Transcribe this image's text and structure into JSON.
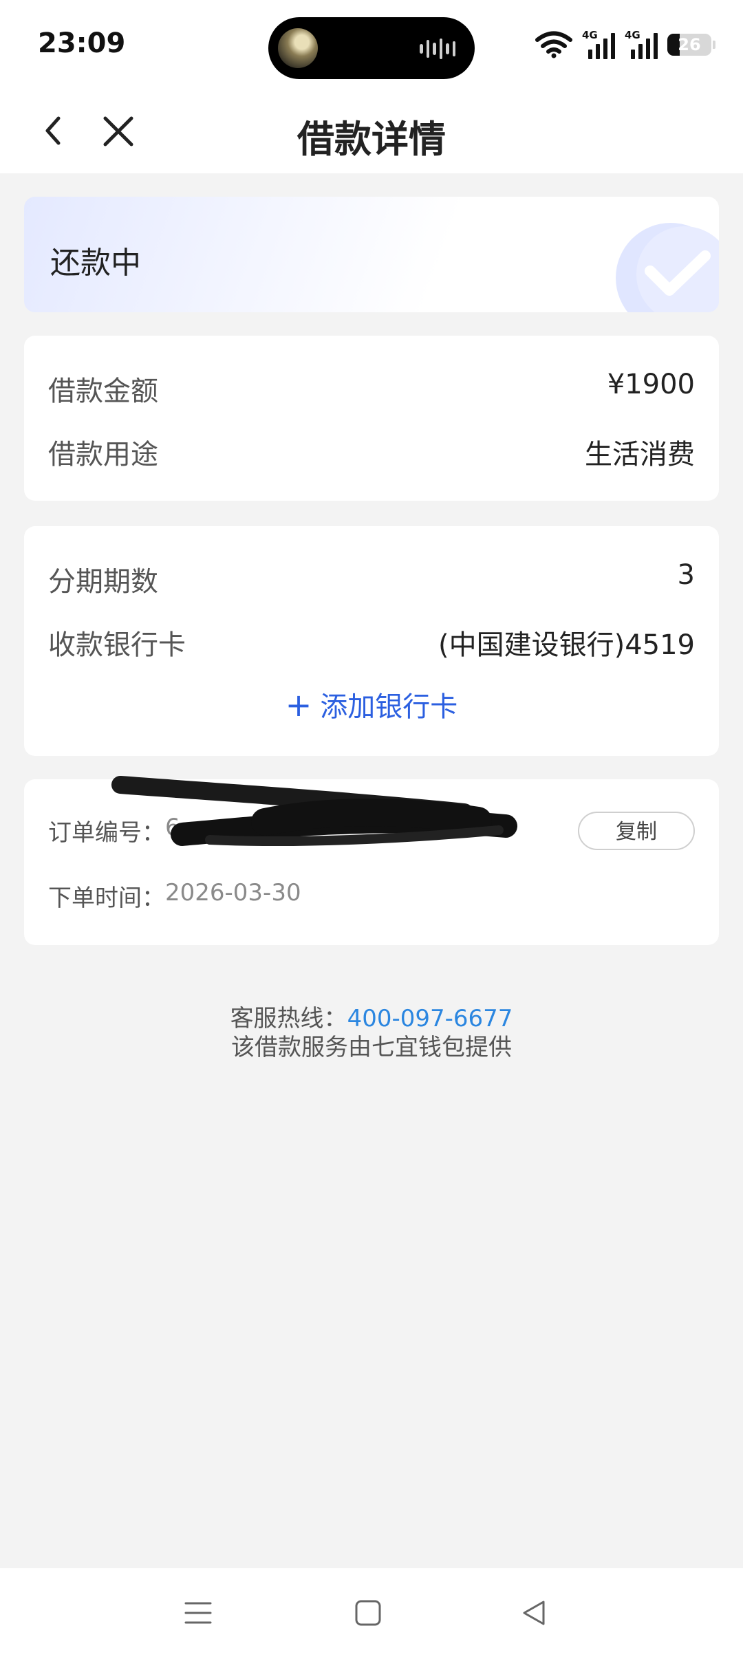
{
  "status_bar": {
    "time": "23:09",
    "network_1": "4G",
    "network_2": "4G",
    "battery": "26"
  },
  "header": {
    "title": "借款详情",
    "back_icon": "chevron-left-icon",
    "close_icon": "close-icon"
  },
  "status": {
    "text": "还款中",
    "icon": "check-badge-icon"
  },
  "loan": {
    "amount_label": "借款金额",
    "amount_value": "¥1900",
    "purpose_label": "借款用途",
    "purpose_value": "生活消费"
  },
  "installment": {
    "periods_label": "分期期数",
    "periods_value": "3",
    "bank_label": "收款银行卡",
    "bank_value": "(中国建设银行)4519",
    "add_card_label": "添加银行卡",
    "add_card_icon": "plus-icon"
  },
  "order": {
    "number_label": "订单编号：",
    "number_value": "6",
    "copy_label": "复制",
    "time_label": "下单时间：",
    "time_value": "2026-03-30"
  },
  "footer": {
    "hotline_label": "客服热线：",
    "hotline_number": "400-097-6677",
    "provider_text": "该借款服务由七宜钱包提供"
  },
  "colors": {
    "accent_blue": "#2b5fe0",
    "link_blue": "#2b86e0",
    "page_bg": "#f3f3f3"
  }
}
